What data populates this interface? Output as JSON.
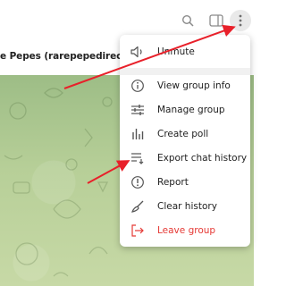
{
  "header": {
    "icons": [
      "search-icon",
      "sidebar-toggle-icon",
      "more-vertical-icon"
    ]
  },
  "chat": {
    "title": "e Pepes (rarepepedirectory."
  },
  "menu": {
    "items": [
      {
        "label": "Unmute",
        "icon": "speaker-icon"
      },
      {
        "label": "View group info",
        "icon": "info-icon"
      },
      {
        "label": "Manage group",
        "icon": "sliders-icon"
      },
      {
        "label": "Create poll",
        "icon": "poll-icon"
      },
      {
        "label": "Export chat history",
        "icon": "export-list-icon"
      },
      {
        "label": "Report",
        "icon": "report-icon"
      },
      {
        "label": "Clear history",
        "icon": "broom-icon"
      },
      {
        "label": "Leave group",
        "icon": "leave-icon"
      }
    ]
  },
  "colors": {
    "danger": "#e53935",
    "annotation_arrow": "#e8202a",
    "chat_background": "#b7cf98"
  }
}
